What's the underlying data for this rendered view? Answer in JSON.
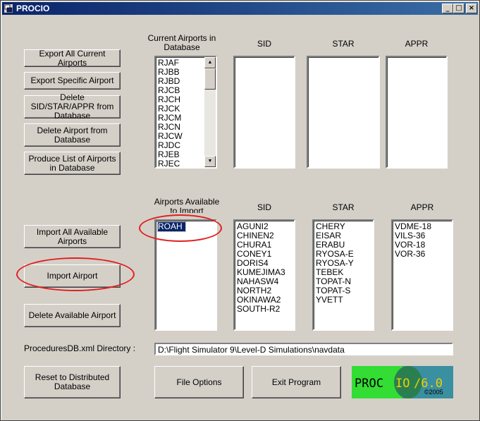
{
  "window": {
    "title": "PROCIO"
  },
  "titlebar_buttons": {
    "minimize": "_",
    "maximize": "□",
    "close": "×"
  },
  "left_buttons": {
    "export_all": "Export All Current Airports",
    "export_specific": "Export Specific Airport",
    "delete_procedures": "Delete SID/STAR/APPR from Database",
    "delete_airport": "Delete Airport from Database",
    "produce_list": "Produce List of Airports in Database",
    "import_all": "Import All Available Airports",
    "import_airport": "Import Airport",
    "delete_available": "Delete Available Airport",
    "reset": "Reset to Distributed Database"
  },
  "current_section": {
    "airports_label": "Current Airports in Database",
    "sid_label": "SID",
    "star_label": "STAR",
    "appr_label": "APPR",
    "airports": [
      "RJAF",
      "RJBB",
      "RJBD",
      "RJCB",
      "RJCH",
      "RJCK",
      "RJCM",
      "RJCN",
      "RJCW",
      "RJDC",
      "RJEB",
      "RJEC"
    ],
    "sid": [],
    "star": [],
    "appr": []
  },
  "available_section": {
    "airports_label": "Airports Available to Import",
    "sid_label": "SID",
    "star_label": "STAR",
    "appr_label": "APPR",
    "airports": [
      "ROAH"
    ],
    "selected_airport": "ROAH",
    "sid": [
      "AGUNI2",
      "CHINEN2",
      "CHURA1",
      "CONEY1",
      "DORIS4",
      "KUMEJIMA3",
      "NAHASW4",
      "NORTH2",
      "OKINAWA2",
      "SOUTH-R2"
    ],
    "star": [
      "CHERY",
      "EISAR",
      "ERABU",
      "RYOSA-E",
      "RYOSA-Y",
      "TEBEK",
      "TOPAT-N",
      "TOPAT-S",
      "YVETT"
    ],
    "appr": [
      "VDME-18",
      "VILS-36",
      "VOR-18",
      "VOR-36"
    ]
  },
  "directory": {
    "label": "ProceduresDB.xml Directory :",
    "value": "D:\\Flight Simulator 9\\Level-D Simulations\\navdata"
  },
  "bottom_buttons": {
    "file_options": "File Options",
    "exit": "Exit Program"
  },
  "logo": {
    "text_left": "PROC",
    "text_io": "IO",
    "version": "/6.0",
    "copyright": "©2005",
    "colors": {
      "green": "#33dd33",
      "teal": "#3a8fa0",
      "yellow": "#f0d000"
    }
  },
  "annotation_color": "#e02020"
}
